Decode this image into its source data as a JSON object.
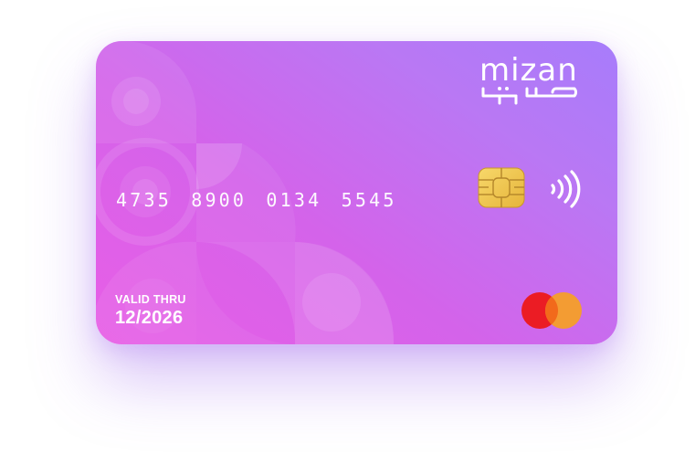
{
  "card": {
    "brand_name": "mizan",
    "brand_name_arabic": "ميزان",
    "number": "4735 8900 0134 5545",
    "valid_thru_label": "VALID THRU",
    "valid_thru_value": "12/2026",
    "network": "mastercard",
    "chip_icon": "emv-chip-icon",
    "contactless_icon": "contactless-icon"
  },
  "colors": {
    "gradient_start": "#e85ee6",
    "gradient_mid": "#d463ea",
    "gradient_end": "#a77cfb",
    "chip_gold": "#f2c84b",
    "network_red": "#eb1c24",
    "network_orange": "#f39c33",
    "network_overlap": "#f26a1b"
  }
}
